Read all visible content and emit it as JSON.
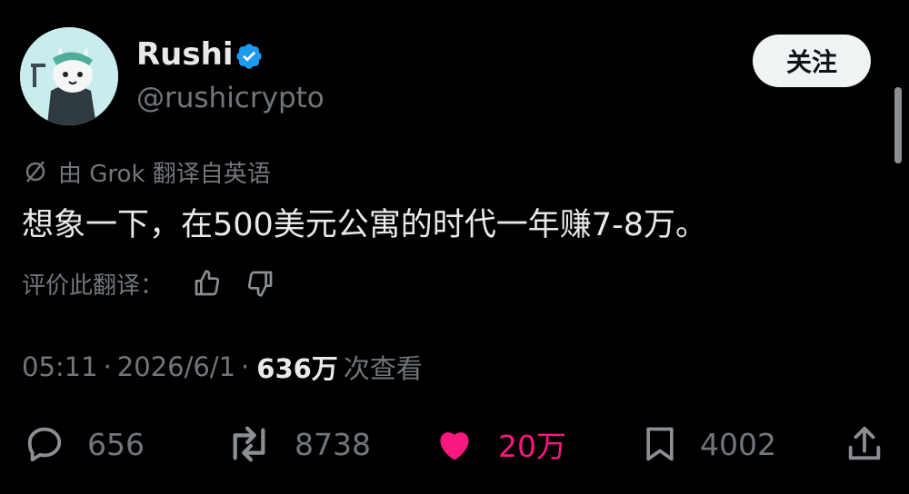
{
  "author": {
    "name": "Rushi",
    "handle": "@rushicrypto",
    "verified": true,
    "verified_color": "#1d9bf0"
  },
  "follow_button": {
    "label": "关注"
  },
  "translation": {
    "icon": "translate-icon",
    "label": "由 Grok 翻译自英语"
  },
  "tweet": {
    "text": "想象一下，在500美元公寓的时代一年赚7-8万。"
  },
  "rate_translation": {
    "label": "评价此翻译：",
    "thumbs_up_icon": "thumbs-up-icon",
    "thumbs_down_icon": "thumbs-down-icon"
  },
  "meta": {
    "time": "05:11",
    "separator": "·",
    "date": "2026/6/1",
    "views_count": "636万",
    "views_label": "次查看"
  },
  "actions": {
    "replies": {
      "icon": "reply-icon",
      "count": "656"
    },
    "retweets": {
      "icon": "retweet-icon",
      "count": "8738"
    },
    "likes": {
      "icon": "heart-icon",
      "count": "20万",
      "liked": true,
      "color": "#f91880"
    },
    "bookmarks": {
      "icon": "bookmark-icon",
      "count": "4002"
    },
    "share": {
      "icon": "share-icon"
    }
  }
}
